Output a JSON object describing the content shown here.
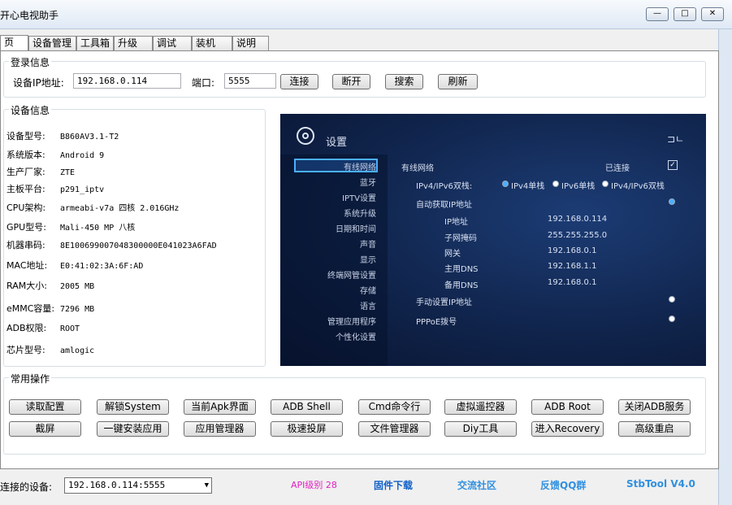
{
  "window": {
    "title": "开心电视助手",
    "controls": {
      "minimize": "—",
      "maximize": "□",
      "close": "✕"
    }
  },
  "tabs": [
    "页",
    "设备管理",
    "工具箱",
    "升级",
    "调试",
    "装机",
    "说明"
  ],
  "login": {
    "group_label": "登录信息",
    "ip_label": "设备IP地址:",
    "ip_value": "192.168.0.114",
    "port_label": "端口:",
    "port_value": "5555",
    "buttons": [
      "连接",
      "断开",
      "搜索",
      "刷新"
    ]
  },
  "device_info": {
    "group_label": "设备信息",
    "rows": [
      {
        "k": "设备型号:",
        "v": "B860AV3.1-T2"
      },
      {
        "k": "系统版本:",
        "v": "Android 9"
      },
      {
        "k": "生产厂家:",
        "v": "ZTE"
      },
      {
        "k": "主板平台:",
        "v": "p291_iptv"
      },
      {
        "k": "CPU架构:",
        "v": "armeabi-v7a 四核 2.016GHz"
      },
      {
        "k": "GPU型号:",
        "v": "Mali-450 MP 八核"
      },
      {
        "k": "机器串码:",
        "v": "8E100699007048300000E041023A6FAD"
      },
      {
        "k": "MAC地址:",
        "v": "E0:41:02:3A:6F:AD"
      },
      {
        "k": "RAM大小:",
        "v": "2005 MB"
      },
      {
        "k": "eMMC容量:",
        "v": "7296 MB"
      },
      {
        "k": "ADB权限:",
        "v": "ROOT"
      },
      {
        "k": "芯片型号:",
        "v": "amlogic"
      }
    ]
  },
  "screen": {
    "title": "设置",
    "menu": [
      "有线网络",
      "蓝牙",
      "IPTV设置",
      "系统升级",
      "日期和时间",
      "声音",
      "显示",
      "终端网管设置",
      "存储",
      "语言",
      "管理应用程序",
      "个性化设置"
    ],
    "section": "有线网络",
    "connected": "已连接",
    "dual_label": "IPv4/IPv6双栈:",
    "dual_options": [
      "IPv4单栈",
      "IPv6单栈",
      "IPv4/IPv6双栈"
    ],
    "auto_ip": "自动获取IP地址",
    "fields": [
      {
        "k": "IP地址",
        "v": "192.168.0.114"
      },
      {
        "k": "子网掩码",
        "v": "255.255.255.0"
      },
      {
        "k": "网关",
        "v": "192.168.0.1"
      },
      {
        "k": "主用DNS",
        "v": "192.168.1.1"
      },
      {
        "k": "备用DNS",
        "v": "192.168.0.1"
      }
    ],
    "manual_ip": "手动设置IP地址",
    "pppoe": "PPPoE拨号"
  },
  "ops": {
    "group_label": "常用操作",
    "row1": [
      "读取配置",
      "解锁System",
      "当前Apk界面",
      "ADB Shell",
      "Cmd命令行",
      "虚拟遥控器",
      "ADB  Root",
      "关闭ADB服务"
    ],
    "row2": [
      "截屏",
      "一键安装应用",
      "应用管理器",
      "极速投屏",
      "文件管理器",
      "Diy工具",
      "进入Recovery",
      "高级重启"
    ]
  },
  "status": {
    "device_label": "连接的设备:",
    "device_value": "192.168.0.114:5555",
    "api": "API级别 28",
    "links": [
      "固件下载",
      "交流社区",
      "反馈QQ群",
      "StbTool V4.0"
    ],
    "colors": {
      "api": "#e020c0",
      "firmware": "#1060c8",
      "community": "#3090e0",
      "feedback": "#3090e0",
      "version": "#3090e0"
    }
  }
}
